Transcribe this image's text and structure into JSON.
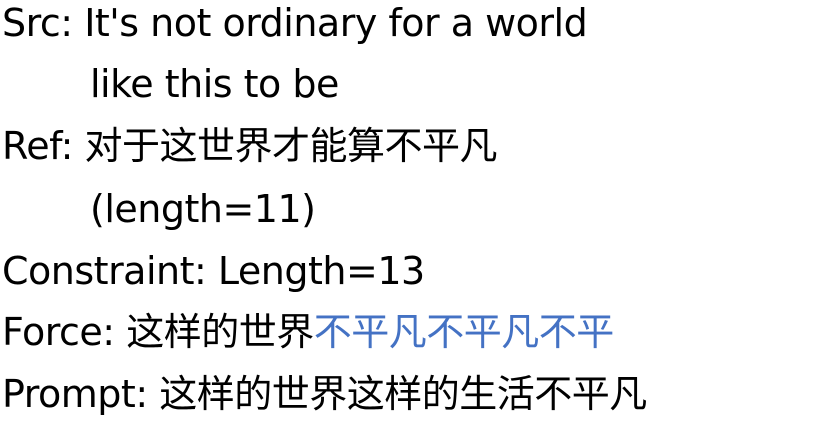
{
  "src": {
    "label": "Src:",
    "text_line1": "It's not ordinary for a world",
    "text_line2": "like this to be"
  },
  "ref": {
    "label": "Ref:",
    "text": "对于这世界才能算不平凡",
    "length_note": "(length=11)"
  },
  "constraint": {
    "label": "Constraint:",
    "text": "Length=13"
  },
  "force": {
    "label": "Force:",
    "text_plain": "这样的世界",
    "text_highlight": "不平凡不平凡不平"
  },
  "prompt": {
    "label": "Prompt:",
    "text": "这样的世界这样的生活不平凡"
  },
  "colors": {
    "text": "#000000",
    "highlight": "#4472c4",
    "background": "#ffffff"
  }
}
